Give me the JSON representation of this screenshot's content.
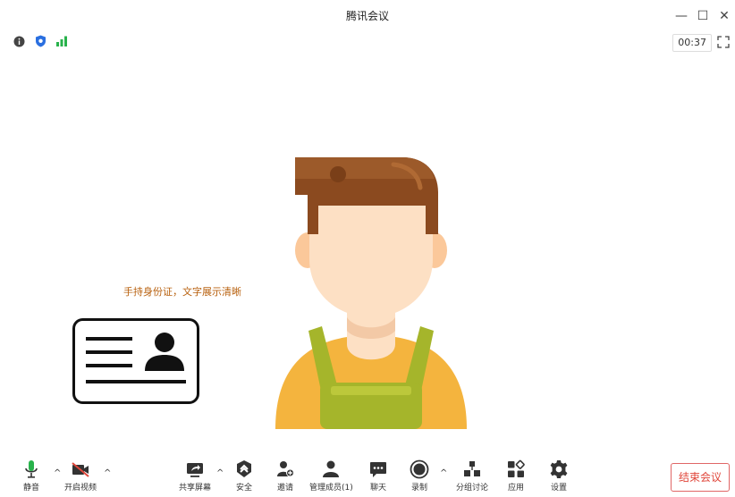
{
  "window": {
    "title": "腾讯会议"
  },
  "status": {
    "timer": "00:37"
  },
  "hint": {
    "text": "手持身份证，文字展示清晰"
  },
  "toolbar": {
    "mute": "静音",
    "video": "开启视频",
    "share": "共享屏幕",
    "security": "安全",
    "invite": "邀请",
    "members": "管理成员(1)",
    "chat": "聊天",
    "record": "录制",
    "breakout": "分组讨论",
    "apps": "应用",
    "settings": "设置",
    "end": "结束会议"
  },
  "colors": {
    "accent_green": "#28b24b",
    "end_red": "#e0463a",
    "hint_orange": "#b8610f",
    "hair": "#8b4a1f",
    "skin": "#fde0c4",
    "shirt": "#f4b43e",
    "overall": "#a5b52b"
  }
}
